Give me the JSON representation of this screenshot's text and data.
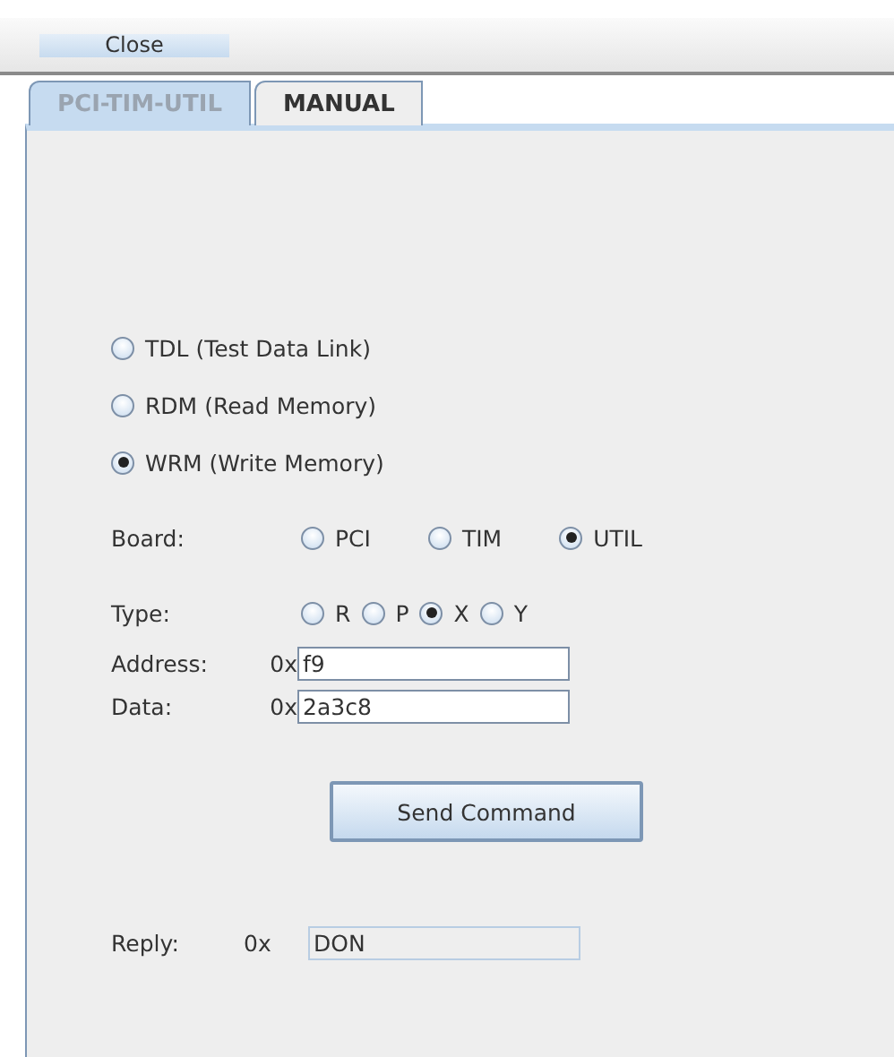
{
  "toolbar": {
    "close_button": "Close"
  },
  "tabs": [
    {
      "label": "PCI-TIM-UTIL",
      "selected": true
    },
    {
      "label": "MANUAL",
      "selected": false
    }
  ],
  "commands": [
    {
      "label": "TDL (Test Data Link)",
      "selected": false
    },
    {
      "label": "RDM (Read Memory)",
      "selected": false
    },
    {
      "label": "WRM (Write Memory)",
      "selected": true
    }
  ],
  "board": {
    "label": "Board:",
    "options": [
      {
        "label": "PCI",
        "selected": false
      },
      {
        "label": "TIM",
        "selected": false
      },
      {
        "label": "UTIL",
        "selected": true
      }
    ]
  },
  "type": {
    "label": "Type:",
    "options": [
      {
        "label": "R",
        "selected": false
      },
      {
        "label": "P",
        "selected": false
      },
      {
        "label": "X",
        "selected": true
      },
      {
        "label": "Y",
        "selected": false
      }
    ]
  },
  "address": {
    "label": "Address:",
    "prefix": "0x",
    "value": "f9"
  },
  "data": {
    "label": "Data:",
    "prefix": "0x",
    "value": "2a3c8"
  },
  "send_button": "Send Command",
  "reply": {
    "label": "Reply:",
    "prefix": "0x",
    "value": "DON",
    "disabled": true
  }
}
